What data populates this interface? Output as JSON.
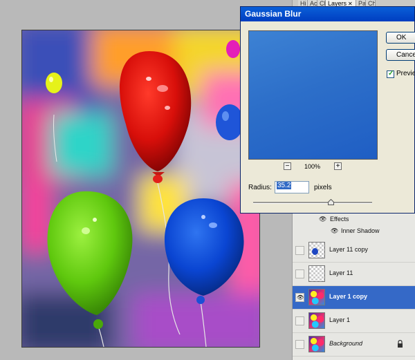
{
  "tabs": [
    {
      "label": "Hi",
      "active": false
    },
    {
      "label": "Ac",
      "active": false
    },
    {
      "label": "Cl",
      "active": false
    },
    {
      "label": "Layers",
      "active": true
    },
    {
      "label": "Pa",
      "active": false
    },
    {
      "label": "Ch",
      "active": false
    }
  ],
  "layers_panel": {
    "effects_label": "Effects",
    "inner_shadow_label": "Inner Shadow",
    "layers": [
      {
        "name": "Layer 11 copy",
        "visible": false,
        "selected": false
      },
      {
        "name": "Layer 11",
        "visible": false,
        "selected": false
      },
      {
        "name": "Layer 1 copy",
        "visible": true,
        "selected": true
      },
      {
        "name": "Layer 1",
        "visible": false,
        "selected": false
      },
      {
        "name": "Background",
        "visible": false,
        "selected": false,
        "locked": true
      }
    ]
  },
  "dialog": {
    "title": "Gaussian Blur",
    "ok_label": "OK",
    "cancel_label": "Cance",
    "preview_label": "Previe",
    "preview_checked": true,
    "zoom_minus": "−",
    "zoom_plus": "+",
    "zoom_level": "100%",
    "radius_label": "Radius:",
    "radius_value": "35.2",
    "pixels_label": "pixels",
    "slider_fraction": 0.69
  },
  "colors": {
    "selection": "#3569c7",
    "title_bar": "#0a5fd8",
    "preview_fill": "#2d6fc9"
  }
}
